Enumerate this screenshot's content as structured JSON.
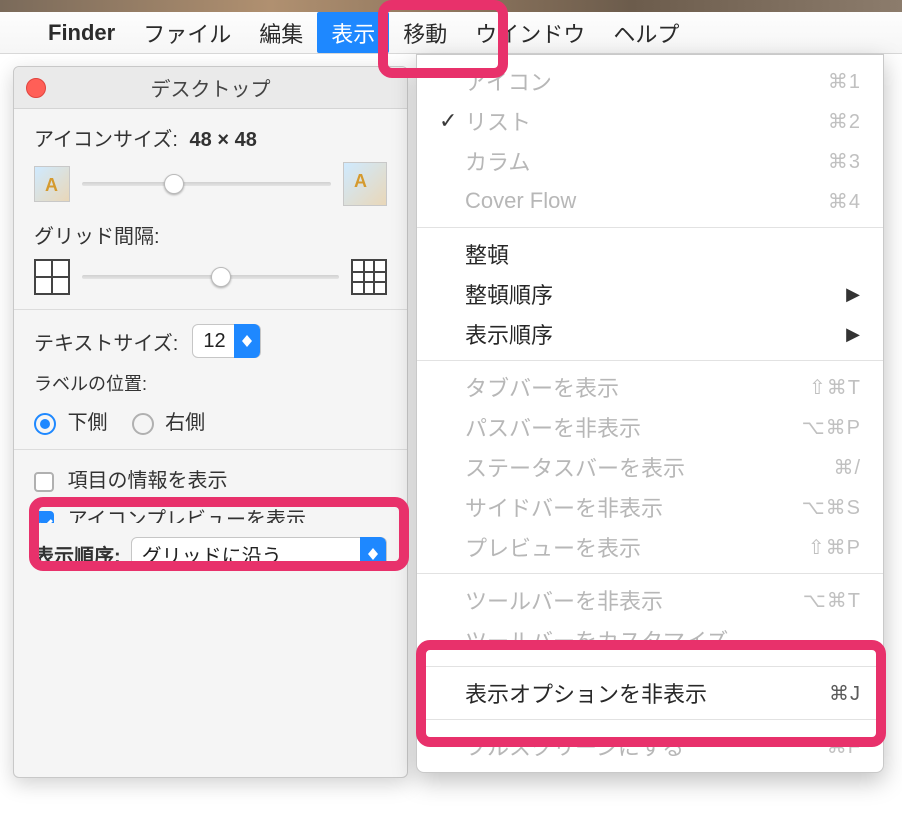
{
  "menubar": {
    "app": "Finder",
    "items": [
      "ファイル",
      "編集",
      "表示",
      "移動",
      "ウインドウ",
      "ヘルプ"
    ],
    "highlighted_index": 2
  },
  "panel": {
    "title": "デスクトップ",
    "iconSizeLabel": "アイコンサイズ:",
    "iconSizeValue": "48 × 48",
    "iconSliderPos": 0.33,
    "gridLabel": "グリッド間隔:",
    "gridSliderPos": 0.5,
    "textSizeLabel": "テキストサイズ:",
    "textSizeValue": "12",
    "labelPosLabel": "ラベルの位置:",
    "labelPosOptions": [
      "下側",
      "右側"
    ],
    "labelPosSelected": 0,
    "showInfoLabel": "項目の情報を表示",
    "showInfoChecked": false,
    "iconPreviewLabel": "アイコンプレビューを表示",
    "iconPreviewChecked": true,
    "sortLabel": "表示順序:",
    "sortValue": "グリッドに沿う"
  },
  "menu": {
    "items": [
      {
        "label": "アイコン",
        "shortcut": "⌘1",
        "checked": false,
        "disabled": true
      },
      {
        "label": "リスト",
        "shortcut": "⌘2",
        "checked": true,
        "disabled": true
      },
      {
        "label": "カラム",
        "shortcut": "⌘3",
        "checked": false,
        "disabled": true
      },
      {
        "label": "Cover Flow",
        "shortcut": "⌘4",
        "checked": false,
        "disabled": true
      },
      {
        "sep": true
      },
      {
        "label": "整頓",
        "shortcut": "",
        "checked": false,
        "disabled": false
      },
      {
        "label": "整頓順序",
        "shortcut": "",
        "submenu": true,
        "disabled": false
      },
      {
        "label": "表示順序",
        "shortcut": "",
        "submenu": true,
        "disabled": false
      },
      {
        "sep": true
      },
      {
        "label": "タブバーを表示",
        "shortcut": "⇧⌘T",
        "disabled": true
      },
      {
        "label": "パスバーを非表示",
        "shortcut": "⌥⌘P",
        "disabled": true
      },
      {
        "label": "ステータスバーを表示",
        "shortcut": "⌘/",
        "disabled": true
      },
      {
        "label": "サイドバーを非表示",
        "shortcut": "⌥⌘S",
        "disabled": true
      },
      {
        "label": "プレビューを表示",
        "shortcut": "⇧⌘P",
        "disabled": true
      },
      {
        "sep": true
      },
      {
        "label": "ツールバーを非表示",
        "shortcut": "⌥⌘T",
        "disabled": true
      },
      {
        "label": "ツールバーをカスタマイズ…",
        "shortcut": "",
        "disabled": true
      },
      {
        "sep": true
      },
      {
        "label": "表示オプションを非表示",
        "shortcut": "⌘J",
        "disabled": false
      },
      {
        "sep": true
      },
      {
        "label": "フルスクリーンにする",
        "shortcut": "^⌘F",
        "disabled": true
      }
    ]
  }
}
